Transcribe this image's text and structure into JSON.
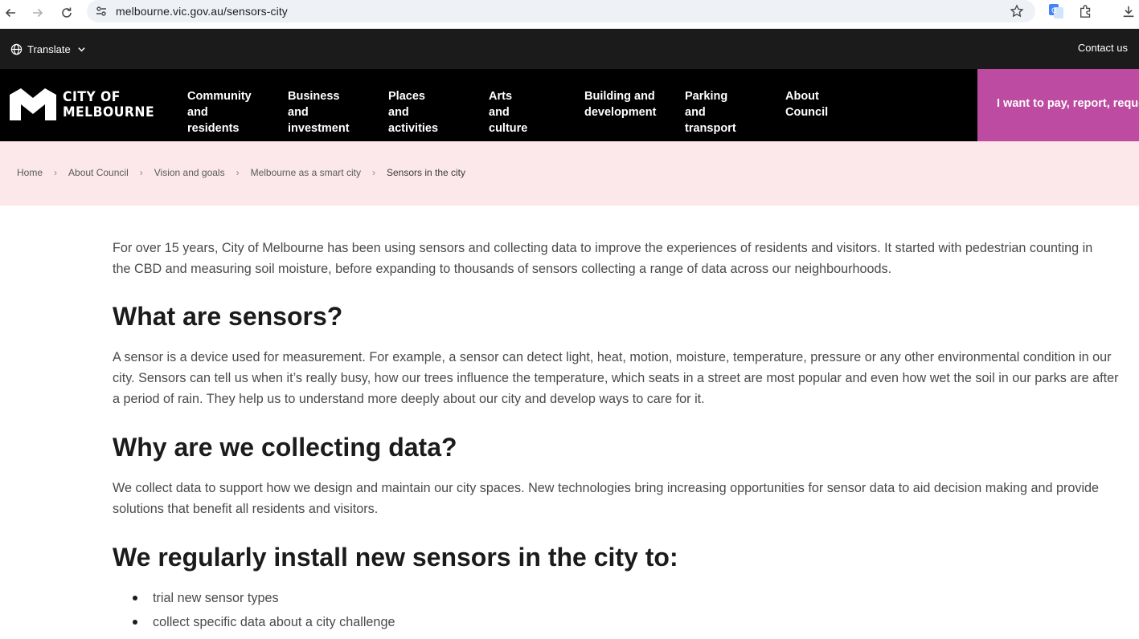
{
  "browser": {
    "url": "melbourne.vic.gov.au/sensors-city"
  },
  "utility": {
    "translate_label": "Translate",
    "contact_label": "Contact us"
  },
  "logo": {
    "line1": "CITY OF",
    "line2": "MELBOURNE"
  },
  "nav": {
    "items": [
      {
        "label": "Community\nand residents"
      },
      {
        "label": "Business and\ninvestment"
      },
      {
        "label": "Places and\nactivities"
      },
      {
        "label": "Arts and\nculture"
      },
      {
        "label": "Building and\ndevelopment"
      },
      {
        "label": "Parking and\ntransport"
      },
      {
        "label": "About\nCouncil"
      }
    ],
    "cta_label": "I want to pay, report, request"
  },
  "breadcrumb": {
    "items": [
      "Home",
      "About Council",
      "Vision and goals",
      "Melbourne as a smart city",
      "Sensors in the city"
    ]
  },
  "content": {
    "intro": "For over 15 years, City of Melbourne has been using sensors and collecting data to improve the experiences of residents and visitors. It started with pedestrian counting in the CBD and measuring soil moisture, before expanding to thousands of sensors collecting a range of data across our neighbourhoods.",
    "what_heading": "What are sensors?",
    "what_text": "A sensor is a device used for measurement. For example, a sensor can detect light, heat, motion, moisture, temperature, pressure or any other environmental condition in our city. Sensors can tell us when it’s really busy, how our trees influence the temperature, which seats in a street are most popular and even how wet the soil in our parks are after a period of rain. They help us to understand more deeply about our city and develop ways to care for it.",
    "why_heading": "Why are we collecting data?",
    "why_text": "We collect data to support how we design and maintain our city spaces. New technologies bring increasing opportunities for sensor data to aid decision making and provide solutions that benefit all residents and visitors.",
    "install_heading": "We regularly install new sensors in the city to:",
    "bullets": [
      "trial new sensor types",
      "collect specific data about a city challenge"
    ]
  },
  "colors": {
    "header_bg": "#000000",
    "utility_bg": "#1b1b1b",
    "cta_bg": "#bd4ba1",
    "breadcrumb_bg": "#fce8ea"
  },
  "icons": [
    "back-arrow-icon",
    "forward-arrow-icon",
    "reload-icon",
    "site-info-icon",
    "star-icon",
    "translate-extension-icon",
    "extensions-icon",
    "download-icon",
    "globe-icon",
    "chevron-down-icon",
    "city-of-melbourne-logo"
  ]
}
